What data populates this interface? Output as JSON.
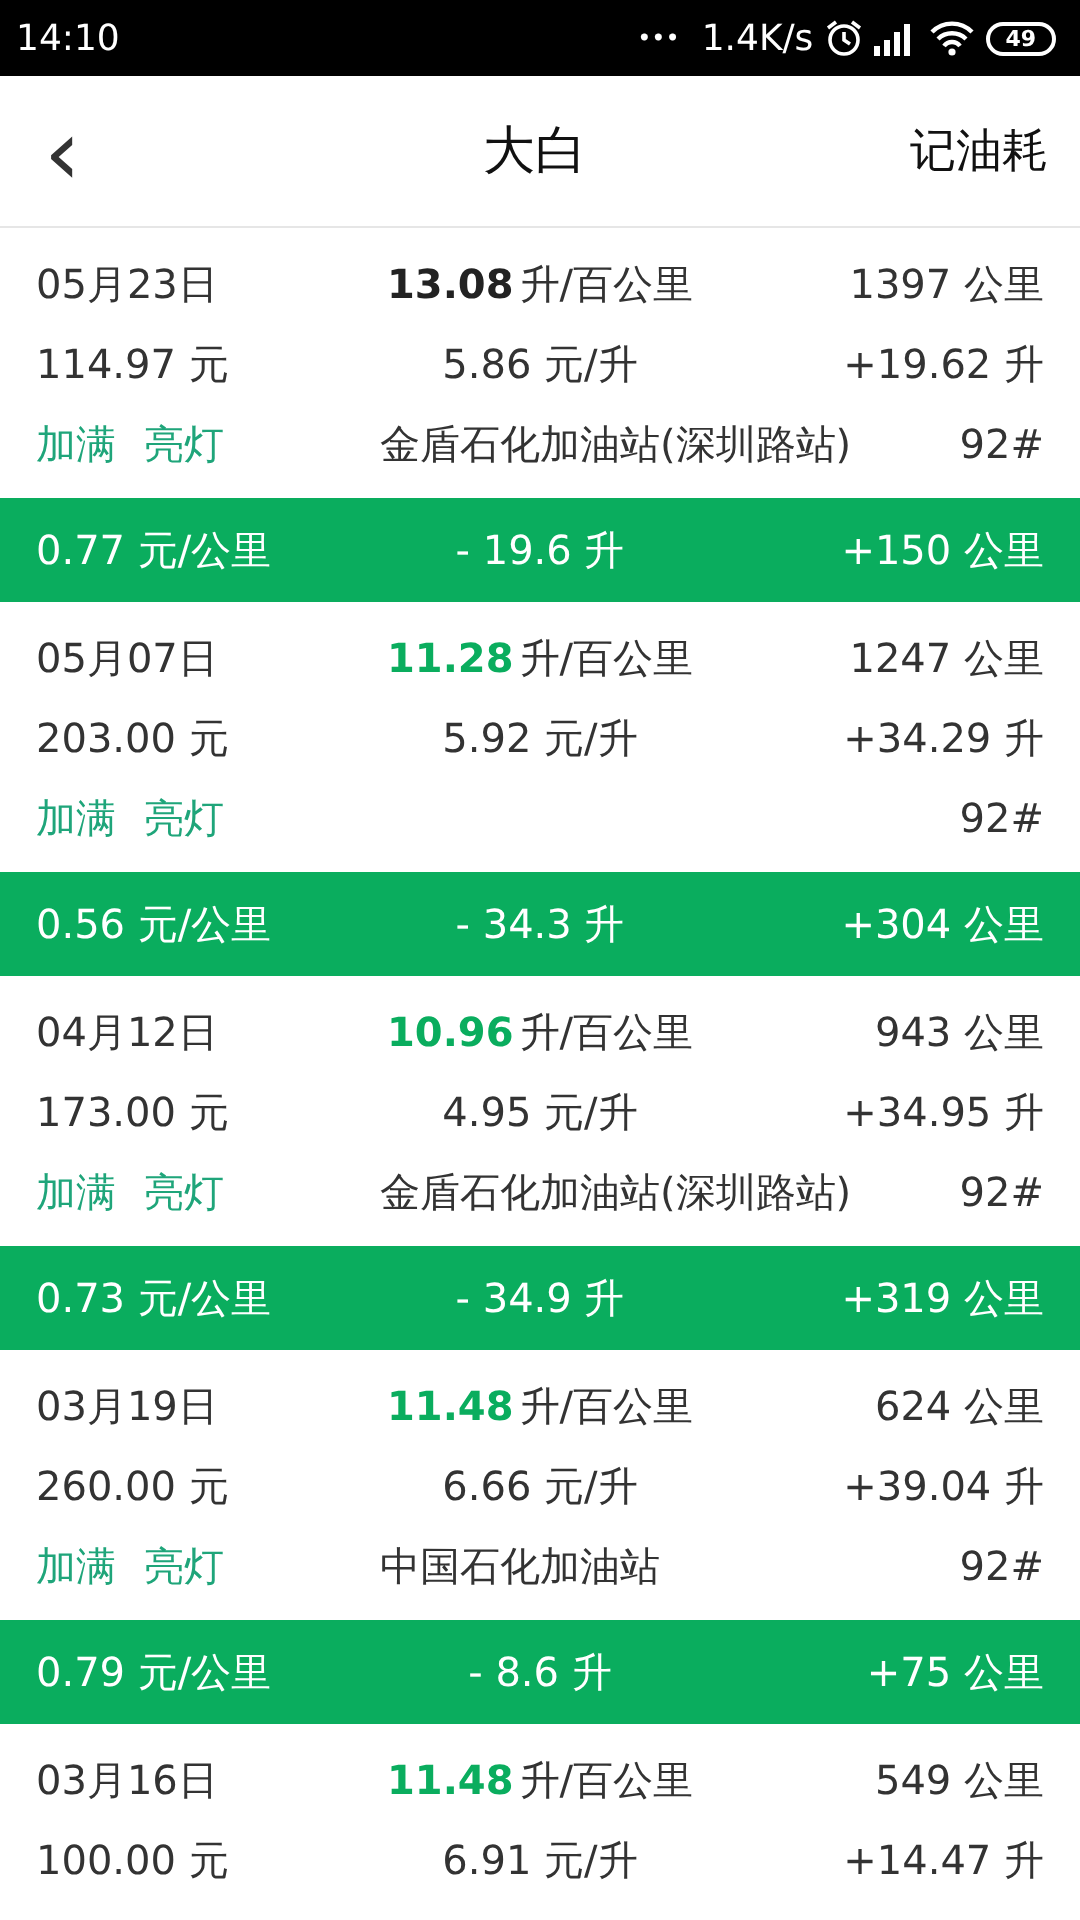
{
  "status_bar": {
    "time": "14:10",
    "dots": "•••",
    "speed": "1.4K/s",
    "battery": "49"
  },
  "header": {
    "back": "‹",
    "title": "大白",
    "action": "记油耗"
  },
  "entries": [
    {
      "date": "05月23日",
      "consumption": "13.08",
      "consumption_unit": "升/百公里",
      "highlighted": false,
      "odometer": "1397 公里",
      "cost": "114.97 元",
      "price": "5.86 元/升",
      "liters": "+19.62 升",
      "tags": [
        "加满",
        "亮灯"
      ],
      "station": "金盾石化加油站(深圳路站)",
      "grade": "92#",
      "summary": {
        "cost_per_km": "0.77 元/公里",
        "fuel_diff": "- 19.6 升",
        "distance_diff": "+150 公里"
      }
    },
    {
      "date": "05月07日",
      "consumption": "11.28",
      "consumption_unit": "升/百公里",
      "highlighted": true,
      "odometer": "1247 公里",
      "cost": "203.00 元",
      "price": "5.92 元/升",
      "liters": "+34.29 升",
      "tags": [
        "加满",
        "亮灯"
      ],
      "grade": "92#",
      "summary": {
        "cost_per_km": "0.56 元/公里",
        "fuel_diff": "- 34.3 升",
        "distance_diff": "+304 公里"
      }
    },
    {
      "date": "04月12日",
      "consumption": "10.96",
      "consumption_unit": "升/百公里",
      "highlighted": true,
      "odometer": "943 公里",
      "cost": "173.00 元",
      "price": "4.95 元/升",
      "liters": "+34.95 升",
      "tags": [
        "加满",
        "亮灯"
      ],
      "station": "金盾石化加油站(深圳路站)",
      "grade": "92#",
      "summary": {
        "cost_per_km": "0.73 元/公里",
        "fuel_diff": "- 34.9 升",
        "distance_diff": "+319 公里"
      }
    },
    {
      "date": "03月19日",
      "consumption": "11.48",
      "consumption_unit": "升/百公里",
      "highlighted": true,
      "odometer": "624 公里",
      "cost": "260.00 元",
      "price": "6.66 元/升",
      "liters": "+39.04 升",
      "tags": [
        "加满",
        "亮灯"
      ],
      "station": "中国石化加油站",
      "grade": "92#",
      "summary": {
        "cost_per_km": "0.79 元/公里",
        "fuel_diff": "- 8.6 升",
        "distance_diff": "+75 公里"
      }
    },
    {
      "date": "03月16日",
      "consumption": "11.48",
      "consumption_unit": "升/百公里",
      "highlighted": true,
      "odometer": "549 公里",
      "cost": "100.00 元",
      "price": "6.91 元/升",
      "liters": "+14.47 升"
    }
  ]
}
